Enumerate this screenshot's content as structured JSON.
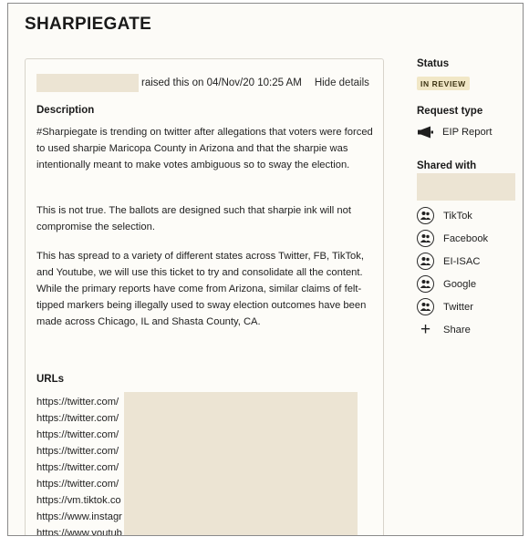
{
  "page": {
    "title": "SHARPIEGATE"
  },
  "ticket": {
    "raised_text": "raised this on 04/Nov/20 10:25 AM",
    "hide_details": "Hide details",
    "description_heading": "Description",
    "paragraphs": [
      "#Sharpiegate is trending on twitter after allegations that voters were forced to used sharpie Maricopa County in Arizona and that the sharpie was intentionally meant to make votes ambiguous so to sway the election.",
      "This is not true. The ballots are designed such that sharpie ink will not compromise the selection.",
      "This has spread to a variety of different states across Twitter, FB, TikTok, and Youtube, we will use this ticket to try and consolidate all the content. While the primary reports have come from Arizona, similar claims of felt-tipped markers being illegally used to sway election outcomes have been made across Chicago, IL and Shasta County, CA."
    ],
    "urls_heading": "URLs",
    "urls": [
      "https://twitter.com/",
      "https://twitter.com/",
      "https://twitter.com/",
      "https://twitter.com/",
      "https://twitter.com/",
      "https://twitter.com/",
      "https://vm.tiktok.co",
      "https://www.instagr",
      "https://www.youtub"
    ]
  },
  "sidebar": {
    "status_heading": "Status",
    "status_badge": "IN REVIEW",
    "request_type_heading": "Request type",
    "request_type": "EIP Report",
    "request_type_icon": "megaphone-icon",
    "shared_with_heading": "Shared with",
    "shared_with": [
      "TikTok",
      "Facebook",
      "EI-ISAC",
      "Google",
      "Twitter"
    ],
    "shared_icon": "group-icon",
    "share_label": "Share",
    "share_icon": "plus-icon"
  },
  "colors": {
    "redaction": "#ece4d3",
    "badge_bg": "#f1e7c6",
    "badge_text": "#3d3413",
    "page_bg": "#fcfbf7"
  }
}
